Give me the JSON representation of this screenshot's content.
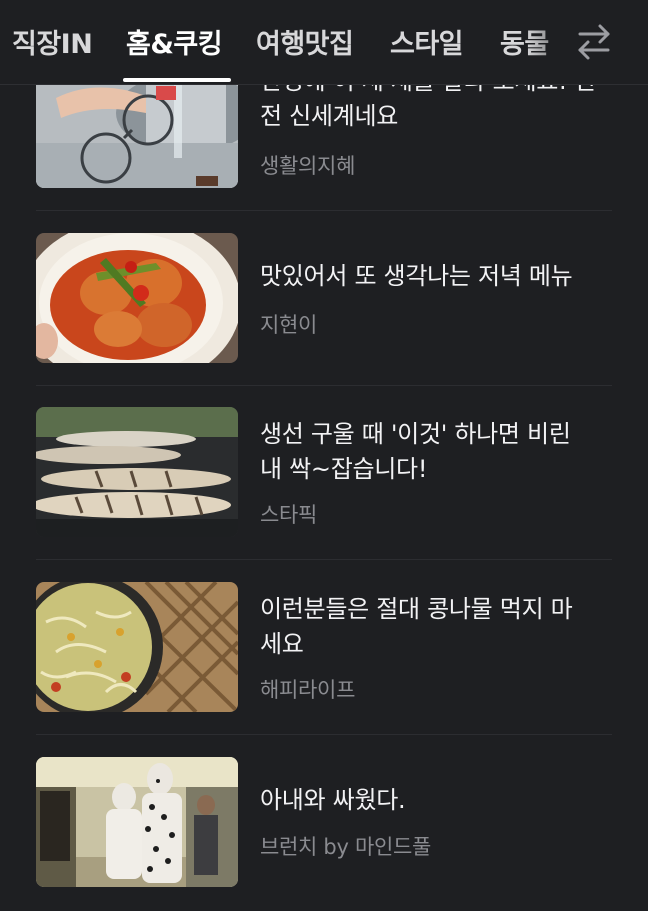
{
  "tabs": [
    {
      "label": "직장IN",
      "active": false
    },
    {
      "label": "홈&쿠킹",
      "active": true
    },
    {
      "label": "여행맛집",
      "active": false
    },
    {
      "label": "스타일",
      "active": false
    },
    {
      "label": "동물",
      "active": false
    }
  ],
  "tabbar": {
    "swap_icon": "swap-arrows-icon"
  },
  "articles": [
    {
      "title_line1": "안경에 이 세 제를 발라 보세요! 완",
      "title_line2": "전 신세계네요",
      "source": "생활의지혜",
      "thumb": "glasses-washing-photo"
    },
    {
      "title_line1": "맛있어서 또 생각나는 저녁 메뉴",
      "title_line2": "",
      "source": "지현이",
      "thumb": "braised-potato-dish-photo"
    },
    {
      "title_line1": "생선 구울 때 '이것' 하나면 비린",
      "title_line2": "내 싹~잡습니다!",
      "source": "스타픽",
      "thumb": "grilled-fish-photo"
    },
    {
      "title_line1": "이런분들은 절대 콩나물 먹지 마",
      "title_line2": "세요",
      "source": "해피라이프",
      "thumb": "bean-sprouts-photo"
    },
    {
      "title_line1": "아내와 싸웠다.",
      "title_line2": "",
      "source": "브런치 by 마인드풀",
      "thumb": "costume-people-photo"
    }
  ]
}
